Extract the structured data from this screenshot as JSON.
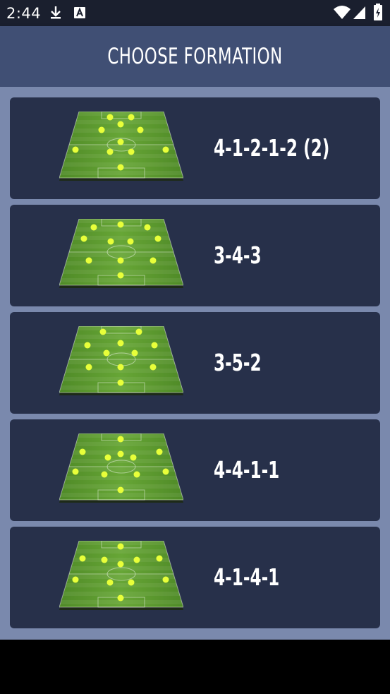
{
  "status_bar": {
    "time": "2:44",
    "icons": [
      "download-icon",
      "a-box-icon",
      "wifi-icon",
      "signal-icon",
      "battery-icon"
    ]
  },
  "header": {
    "title": "CHOOSE FORMATION"
  },
  "formations": [
    {
      "label": "4-1-2-1-2 (2)"
    },
    {
      "label": "3-4-3"
    },
    {
      "label": "3-5-2"
    },
    {
      "label": "4-4-1-1"
    },
    {
      "label": "4-1-4-1"
    }
  ],
  "colors": {
    "status_bar": "#1a1f2e",
    "app_bar": "#404f74",
    "background": "#7a89ad",
    "card": "#27304a",
    "pitch_green": "#5e9a2f",
    "player_dot": "#e8ff3a"
  }
}
